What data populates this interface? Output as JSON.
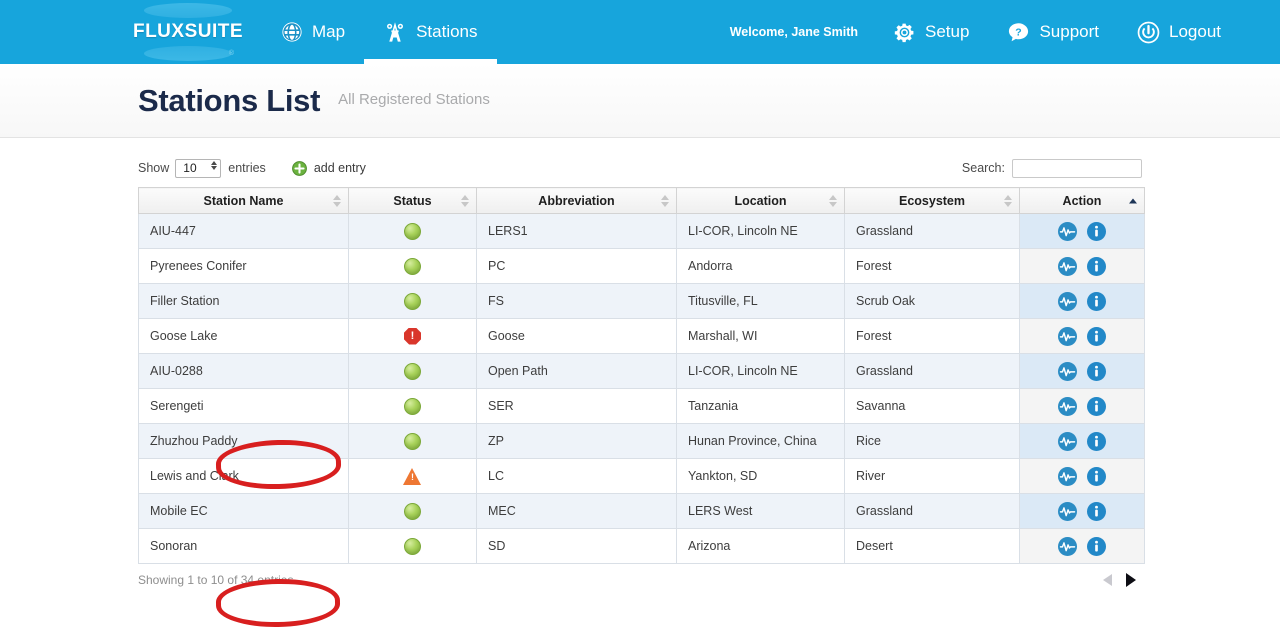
{
  "navbar": {
    "logo_text": "FLUXSUITE",
    "logo_mark": "registered-mark",
    "left_items": [
      {
        "label": "Map",
        "icon": "globe-icon",
        "active": false
      },
      {
        "label": "Stations",
        "icon": "tower-icon",
        "active": true
      }
    ],
    "welcome": "Welcome, Jane Smith",
    "right_items": [
      {
        "label": "Setup",
        "icon": "gear-icon"
      },
      {
        "label": "Support",
        "icon": "help-bubble-icon"
      },
      {
        "label": "Logout",
        "icon": "power-icon"
      }
    ],
    "bg_color": "#17a5dc"
  },
  "page": {
    "title": "Stations List",
    "subtitle": "All Registered Stations"
  },
  "toolbar": {
    "show_label": "Show",
    "entries_value": "10",
    "entries_label": "entries",
    "add_entry_label": "add entry",
    "add_entry_icon": "plus-circle-icon",
    "search_label": "Search:",
    "search_value": "",
    "search_placeholder": ""
  },
  "table": {
    "columns": [
      {
        "label": "Station Name",
        "sorted": false
      },
      {
        "label": "Status",
        "sorted": false
      },
      {
        "label": "Abbreviation",
        "sorted": false
      },
      {
        "label": "Location",
        "sorted": false
      },
      {
        "label": "Ecosystem",
        "sorted": false
      },
      {
        "label": "Action",
        "sorted": true,
        "sort_dir": "asc"
      }
    ],
    "rows": [
      {
        "name": "AIU-447",
        "status": "ok",
        "abbreviation": "LERS1",
        "location": "LI-COR, Lincoln NE",
        "ecosystem": "Grassland"
      },
      {
        "name": "Pyrenees Conifer",
        "status": "ok",
        "abbreviation": "PC",
        "location": "Andorra",
        "ecosystem": "Forest"
      },
      {
        "name": "Filler Station",
        "status": "ok",
        "abbreviation": "FS",
        "location": "Titusville, FL",
        "ecosystem": "Scrub Oak"
      },
      {
        "name": "Goose Lake",
        "status": "error",
        "abbreviation": "Goose",
        "location": "Marshall, WI",
        "ecosystem": "Forest"
      },
      {
        "name": "AIU-0288",
        "status": "ok",
        "abbreviation": "Open Path",
        "location": "LI-COR, Lincoln NE",
        "ecosystem": "Grassland"
      },
      {
        "name": "Serengeti",
        "status": "ok",
        "abbreviation": "SER",
        "location": "Tanzania",
        "ecosystem": "Savanna"
      },
      {
        "name": "Zhuzhou Paddy",
        "status": "ok",
        "abbreviation": "ZP",
        "location": "Hunan Province, China",
        "ecosystem": "Rice"
      },
      {
        "name": "Lewis and Clark",
        "status": "warning",
        "abbreviation": "LC",
        "location": "Yankton, SD",
        "ecosystem": "River"
      },
      {
        "name": "Mobile EC",
        "status": "ok",
        "abbreviation": "MEC",
        "location": "LERS West",
        "ecosystem": "Grassland"
      },
      {
        "name": "Sonoran",
        "status": "ok",
        "abbreviation": "SD",
        "location": "Arizona",
        "ecosystem": "Desert"
      }
    ],
    "action_icons": [
      {
        "name": "pulse-chart-icon",
        "glyph": ""
      },
      {
        "name": "info-icon",
        "glyph": "i"
      }
    ],
    "status_glyphs": {
      "error": "!",
      "warning": "!"
    }
  },
  "footer": {
    "info": "Showing 1 to 10 of 34 entries",
    "prev_label": "Previous page",
    "next_label": "Next page"
  },
  "annotations": [
    {
      "name": "status-highlight-goose-lake",
      "shape": "red-ellipse",
      "color": "#d81f1f"
    },
    {
      "name": "status-highlight-lewis-and-clark",
      "shape": "red-ellipse",
      "color": "#d81f1f"
    }
  ]
}
